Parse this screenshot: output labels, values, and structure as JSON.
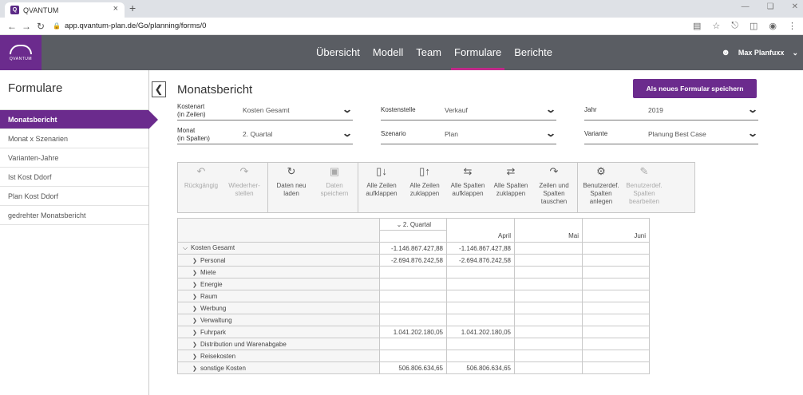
{
  "browser": {
    "tab_title": "QVANTUM",
    "tab_close": "×",
    "new_tab": "+",
    "url": "app.qvantum-plan.de/Go/planning/forms/0"
  },
  "header": {
    "logo_text": "QVANTUM",
    "nav": [
      "Übersicht",
      "Modell",
      "Team",
      "Formulare",
      "Berichte"
    ],
    "active_nav": "Formulare",
    "user_name": "Max Planfuxx"
  },
  "sidebar": {
    "title": "Formulare",
    "items": [
      "Monatsbericht",
      "Monat x Szenarien",
      "Varianten-Jahre",
      "Ist Kost Ddorf",
      "Plan Kost Ddorf",
      "gedrehter Monatsbericht"
    ],
    "active_index": 0
  },
  "main": {
    "title": "Monatsbericht",
    "save_form_label": "Als neues Formular speichern",
    "filters": {
      "kostenart_label_1": "Kostenart",
      "kostenart_label_2": "(in Zeilen)",
      "kostenart_value": "Kosten Gesamt",
      "kostenstelle_label": "Kostenstelle",
      "kostenstelle_value": "Verkauf",
      "jahr_label": "Jahr",
      "jahr_value": "2019",
      "monat_label_1": "Monat",
      "monat_label_2": "(in Spalten)",
      "monat_value": "2. Quartal",
      "szenario_label": "Szenario",
      "szenario_value": "Plan",
      "variante_label": "Variante",
      "variante_value": "Planung Best Case"
    }
  },
  "toolbar": {
    "undo_1": "Rückgängig",
    "redo_1": "Wiederher-",
    "redo_2": "stellen",
    "reload_1": "Daten neu",
    "reload_2": "laden",
    "save_1": "Daten",
    "save_2": "speichern",
    "expand_rows_1": "Alle Zeilen",
    "expand_rows_2": "aufklappen",
    "collapse_rows_1": "Alle Zeilen",
    "collapse_rows_2": "zuklappen",
    "expand_cols_1": "Alle Spalten",
    "expand_cols_2": "aufklappen",
    "collapse_cols_1": "Alle Spalten",
    "collapse_cols_2": "zuklappen",
    "swap_1": "Zeilen und",
    "swap_2": "Spalten",
    "swap_3": "tauschen",
    "create_1": "Benutzerdef.",
    "create_2": "Spalten",
    "create_3": "anlegen",
    "edit_1": "Benutzerdef.",
    "edit_2": "Spalten",
    "edit_3": "bearbeiten"
  },
  "table": {
    "group_header": "2. Quartal",
    "columns": [
      "April",
      "Mai",
      "Juni"
    ],
    "rows": [
      {
        "label": "Kosten Gesamt",
        "level": 0,
        "expanded": true,
        "q2": "-1.146.867.427,88",
        "april": "-1.146.867.427,88",
        "mai": "",
        "juni": ""
      },
      {
        "label": "Personal",
        "level": 1,
        "expanded": false,
        "q2": "-2.694.876.242,58",
        "april": "-2.694.876.242,58",
        "mai": "",
        "juni": ""
      },
      {
        "label": "Miete",
        "level": 1,
        "expanded": false,
        "q2": "",
        "april": "",
        "mai": "",
        "juni": ""
      },
      {
        "label": "Energie",
        "level": 1,
        "expanded": false,
        "q2": "",
        "april": "",
        "mai": "",
        "juni": ""
      },
      {
        "label": "Raum",
        "level": 1,
        "expanded": false,
        "q2": "",
        "april": "",
        "mai": "",
        "juni": ""
      },
      {
        "label": "Werbung",
        "level": 1,
        "expanded": false,
        "q2": "",
        "april": "",
        "mai": "",
        "juni": ""
      },
      {
        "label": "Verwaltung",
        "level": 1,
        "expanded": false,
        "q2": "",
        "april": "",
        "mai": "",
        "juni": ""
      },
      {
        "label": "Fuhrpark",
        "level": 1,
        "expanded": false,
        "q2": "1.041.202.180,05",
        "april": "1.041.202.180,05",
        "mai": "",
        "juni": ""
      },
      {
        "label": "Distribution und Warenabgabe",
        "level": 1,
        "expanded": false,
        "q2": "",
        "april": "",
        "mai": "",
        "juni": ""
      },
      {
        "label": "Reisekosten",
        "level": 1,
        "expanded": false,
        "q2": "",
        "april": "",
        "mai": "",
        "juni": ""
      },
      {
        "label": "sonstige Kosten",
        "level": 1,
        "expanded": false,
        "q2": "506.806.634,65",
        "april": "506.806.634,65",
        "mai": "",
        "juni": ""
      }
    ]
  }
}
